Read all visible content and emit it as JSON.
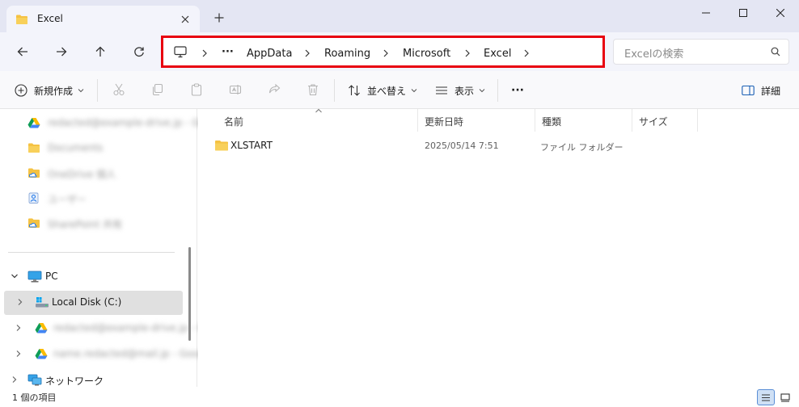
{
  "window": {
    "tab_title": "Excel",
    "controls": {
      "minimize": "minimize",
      "maximize": "maximize",
      "close": "close"
    }
  },
  "navigation": {
    "breadcrumb": [
      "AppData",
      "Roaming",
      "Microsoft",
      "Excel"
    ],
    "overflow": "···",
    "search_placeholder": "Excelの検索"
  },
  "toolbar": {
    "new_label": "新規作成",
    "sort_label": "並べ替え",
    "view_label": "表示",
    "more_label": "···",
    "details_label": "詳細"
  },
  "sidebar": {
    "top_items": [
      {
        "label": "redacted@example-drive.jp - Go...",
        "icon": "google-drive-icon"
      },
      {
        "label": "Documents",
        "icon": "folder-icon"
      },
      {
        "label": "OneDrive 個人",
        "icon": "cloud-folder-icon"
      },
      {
        "label": "ユーザー",
        "icon": "user-folder-icon"
      },
      {
        "label": "SharePoint 共有",
        "icon": "cloud-folder-icon"
      }
    ],
    "pc_label": "PC",
    "pc_items": [
      {
        "label": "Local Disk (C:)",
        "icon": "drive-icon",
        "blurred": false
      },
      {
        "label": "redacted@example-drive.jp - Go...",
        "icon": "google-drive-icon",
        "blurred": true
      },
      {
        "label": "name.redacted@mail.jp - Goog...",
        "icon": "google-drive-icon",
        "blurred": true
      }
    ],
    "network_label": "ネットワーク"
  },
  "columns": {
    "name": "名前",
    "modified": "更新日時",
    "type": "種類",
    "size": "サイズ"
  },
  "files": [
    {
      "name": "XLSTART",
      "modified": "2025/05/14 7:51",
      "type": "ファイル フォルダー",
      "size": ""
    }
  ],
  "status": {
    "item_count": "1 個の項目"
  },
  "colors": {
    "titlebar": "#e4e6f3",
    "navbar": "#f3f4fb",
    "address_highlight": "#e8000f",
    "folder": "#f5c242",
    "selected_row": "#e0e0e0"
  }
}
